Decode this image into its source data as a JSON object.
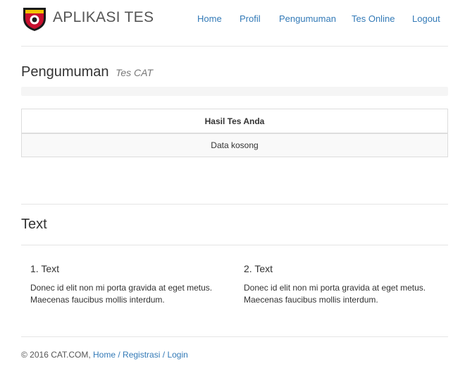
{
  "header": {
    "brand": "APLIKASI TES",
    "nav": [
      "Home",
      "Profil",
      "Pengumuman",
      "Tes Online",
      "Logout"
    ]
  },
  "page": {
    "title": "Pengumuman",
    "subtitle": "Tes CAT"
  },
  "table": {
    "header": "Hasil Tes Anda",
    "empty_message": "Data kosong"
  },
  "section": {
    "title": "Text",
    "columns": [
      {
        "title": "1. Text",
        "body": "Donec id elit non mi porta gravida at eget metus. Maecenas faucibus mollis interdum."
      },
      {
        "title": "2. Text",
        "body": "Donec id elit non mi porta gravida at eget metus. Maecenas faucibus mollis interdum."
      }
    ]
  },
  "footer": {
    "copyright": "© 2016 CAT.COM,",
    "links": [
      "Home",
      "Registrasi",
      "Login"
    ],
    "separator": "/"
  },
  "colors": {
    "link": "#337ab7",
    "logo_primary": "#c8102e",
    "logo_border": "#1a1a1a"
  },
  "icons": {
    "logo": "police-emblem-icon"
  }
}
